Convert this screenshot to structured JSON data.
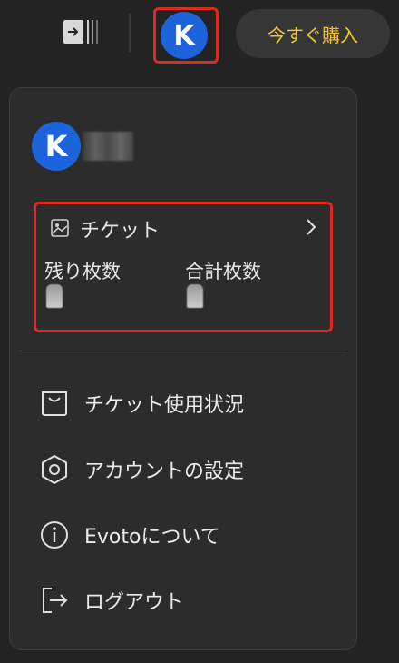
{
  "header": {
    "avatar_letter": "K",
    "buy_button_label": "今すぐ購入"
  },
  "menu": {
    "avatar_letter": "K",
    "ticket": {
      "title": "チケット",
      "remaining_label": "残り枚数",
      "remaining_value": "",
      "total_label": "合計枚数",
      "total_value": ""
    },
    "items": [
      {
        "label": "チケット使用状況",
        "icon": "shopping-bag-icon"
      },
      {
        "label": "アカウントの設定",
        "icon": "settings-hexagon-icon"
      },
      {
        "label": "Evotoについて",
        "icon": "info-icon"
      },
      {
        "label": "ログアウト",
        "icon": "logout-icon"
      }
    ]
  },
  "colors": {
    "background": "#232323",
    "menu_background": "#2c2c2c",
    "accent_yellow": "#f2c530",
    "avatar_blue": "#1d63dc",
    "highlight_red": "#e02a21"
  }
}
